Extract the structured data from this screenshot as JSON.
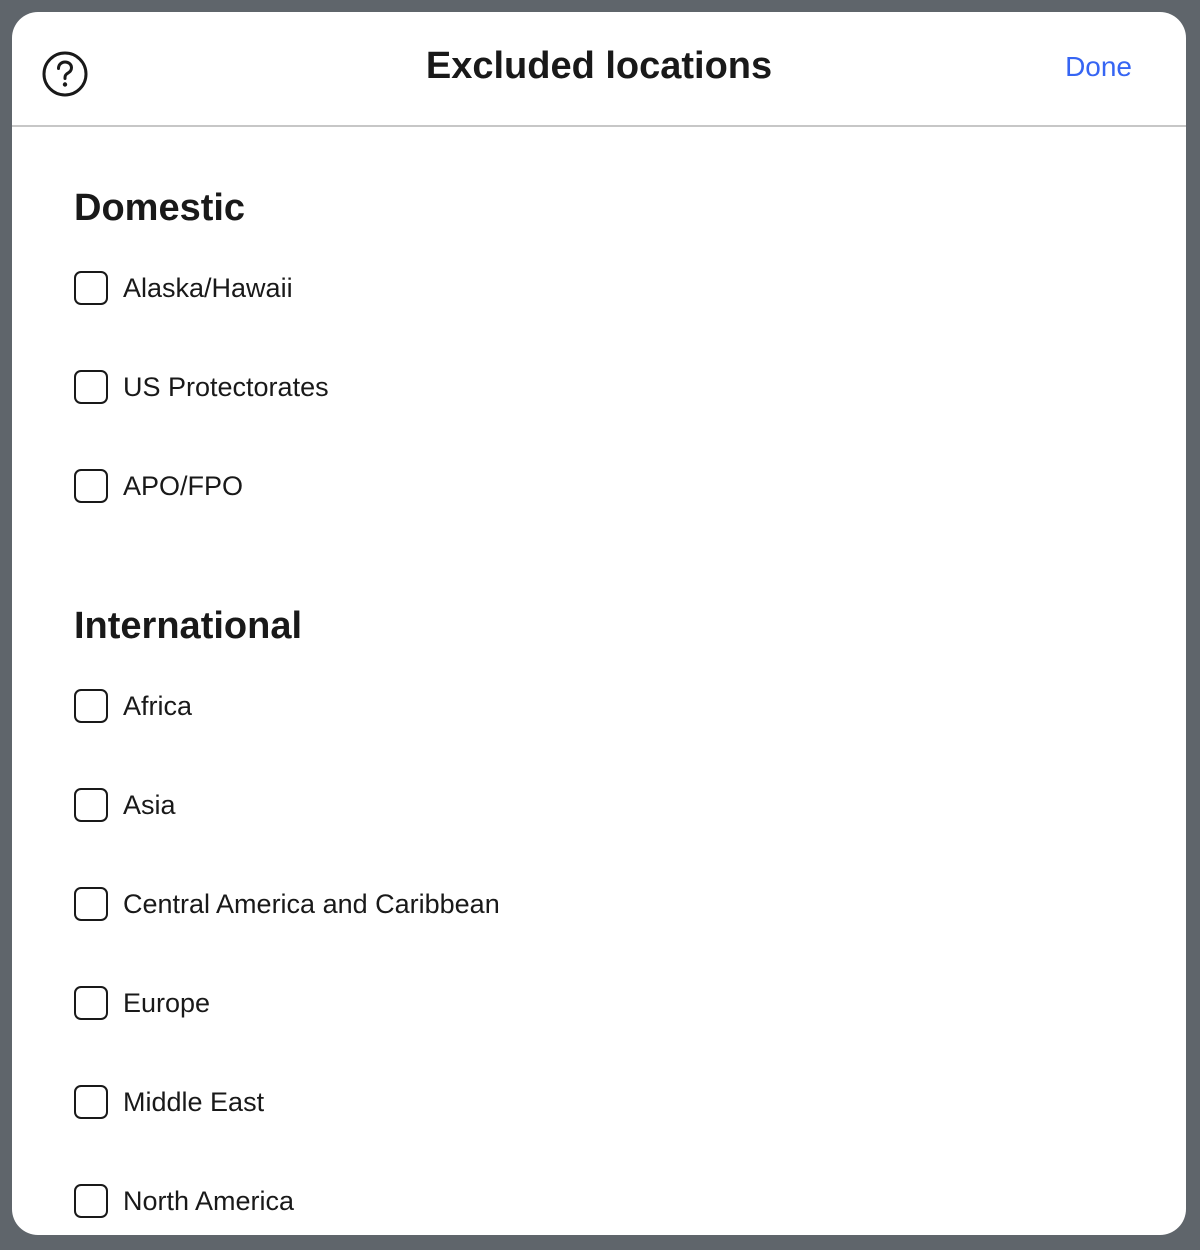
{
  "dialog": {
    "title": "Excluded locations",
    "done_label": "Done",
    "accent_color": "#3665f3"
  },
  "icons": {
    "help": "question-circle-icon"
  },
  "sections": {
    "domestic": {
      "heading": "Domestic",
      "options": [
        {
          "label": "Alaska/Hawaii",
          "checked": false
        },
        {
          "label": "US Protectorates",
          "checked": false
        },
        {
          "label": "APO/FPO",
          "checked": false
        }
      ]
    },
    "international": {
      "heading": "International",
      "options": [
        {
          "label": "Africa",
          "checked": false
        },
        {
          "label": "Asia",
          "checked": false
        },
        {
          "label": "Central America and Caribbean",
          "checked": false
        },
        {
          "label": "Europe",
          "checked": false
        },
        {
          "label": "Middle East",
          "checked": false
        },
        {
          "label": "North America",
          "checked": false
        }
      ]
    }
  }
}
